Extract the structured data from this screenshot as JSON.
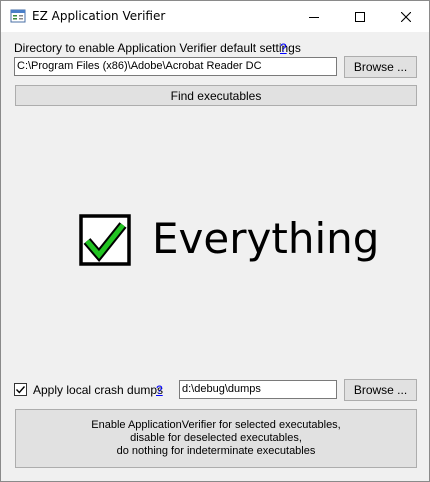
{
  "window": {
    "title": "EZ Application Verifier"
  },
  "directory": {
    "label": "Directory to enable Application Verifier default settings",
    "help": "?",
    "value": "C:\\Program Files (x86)\\Adobe\\Acrobat Reader DC",
    "browse_label": "Browse ..."
  },
  "find_button": {
    "label": "Find executables"
  },
  "status": {
    "text": "Everything"
  },
  "crash_dumps": {
    "checkbox_label": "Apply local crash dumps",
    "checked": true,
    "help": "?",
    "path": "d:\\debug\\dumps",
    "browse_label": "Browse ..."
  },
  "apply_button": {
    "line1": "Enable ApplicationVerifier for selected executables,",
    "line2": "disable for deselected executables,",
    "line3": "do nothing for indeterminate executables"
  },
  "colors": {
    "accent_green": "#1fc01f",
    "link_blue": "#0000ff",
    "window_bg": "#f0f0f0"
  }
}
